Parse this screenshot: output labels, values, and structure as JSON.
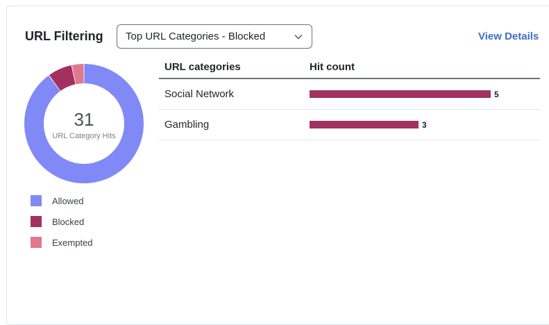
{
  "widget": {
    "title": "URL Filtering",
    "dropdown_value": "Top URL Categories - Blocked",
    "view_details_label": "View Details"
  },
  "summary": {
    "total": "31",
    "caption": "URL Category Hits",
    "segments": [
      {
        "label": "Allowed",
        "value": 27,
        "color": "#8089f6"
      },
      {
        "label": "Blocked",
        "value": 2,
        "color": "#a3305f"
      },
      {
        "label": "Exempted",
        "value": 1,
        "color": "#e07890"
      }
    ]
  },
  "table": {
    "headers": {
      "category": "URL categories",
      "hits": "Hit count"
    },
    "max_hits": 5,
    "rows": [
      {
        "category": "Social Network",
        "hits": 5
      },
      {
        "category": "Gambling",
        "hits": 3
      }
    ]
  }
}
